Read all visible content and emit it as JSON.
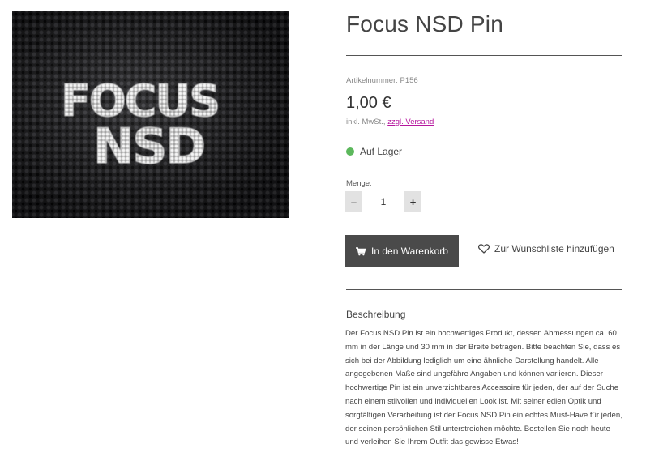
{
  "product": {
    "title": "Focus NSD Pin",
    "sku": "Artikelnummer: P156",
    "price": "1,00 €",
    "tax_prefix": "inkl. MwSt.,",
    "shipping_link": "zzgl. Versand",
    "stock_status": "Auf Lager",
    "stock_color": "#5cb85c",
    "image_text_line1": "FOCUS",
    "image_text_line2": "NSD"
  },
  "quantity": {
    "label": "Menge:",
    "value": "1",
    "decrement": "–",
    "increment": "+"
  },
  "actions": {
    "add_to_cart": "In den Warenkorb",
    "add_to_cart_icon": "cart-icon",
    "wishlist": "Zur Wunschliste hinzufügen",
    "wishlist_icon": "heart-icon",
    "link_color": "#b5179e",
    "button_color": "#4a4a4a"
  },
  "description": {
    "heading": "Beschreibung",
    "text": "Der Focus NSD Pin ist ein hochwertiges Produkt, dessen Abmessungen ca. 60 mm in der Länge und 30 mm in der Breite betragen. Bitte beachten Sie, dass es sich bei der Abbildung lediglich um eine ähnliche Darstellung handelt. Alle angegebenen Maße sind ungefähre Angaben und können variieren. Dieser hochwertige Pin ist ein unverzichtbares Accessoire für jeden, der auf der Suche nach einem stilvollen und individuellen Look ist. Mit seiner edlen Optik und sorgfältigen Verarbeitung ist der Focus NSD Pin ein echtes Must-Have für jeden, der seinen persönlichen Stil unterstreichen möchte. Bestellen Sie noch heute und verleihen Sie Ihrem Outfit das gewisse Etwas!"
  }
}
